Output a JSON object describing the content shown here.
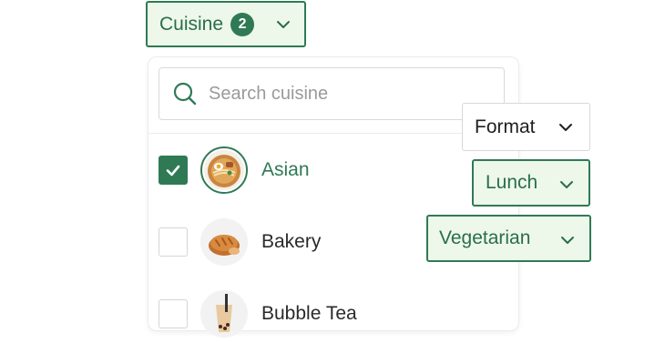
{
  "cuisine_chip": {
    "label": "Cuisine",
    "count": "2"
  },
  "search": {
    "placeholder": "Search cuisine"
  },
  "options": [
    {
      "label": "Asian",
      "checked": true,
      "icon": "ramen-bowl-icon"
    },
    {
      "label": "Bakery",
      "checked": false,
      "icon": "bread-icon"
    },
    {
      "label": "Bubble Tea",
      "checked": false,
      "icon": "bubble-tea-icon"
    }
  ],
  "format_chip": {
    "label": "Format"
  },
  "lunch_chip": {
    "label": "Lunch"
  },
  "vegetarian_chip": {
    "label": "Vegetarian"
  },
  "colors": {
    "accent": "#2f7a55",
    "chip_active_bg": "#edf7ea"
  }
}
